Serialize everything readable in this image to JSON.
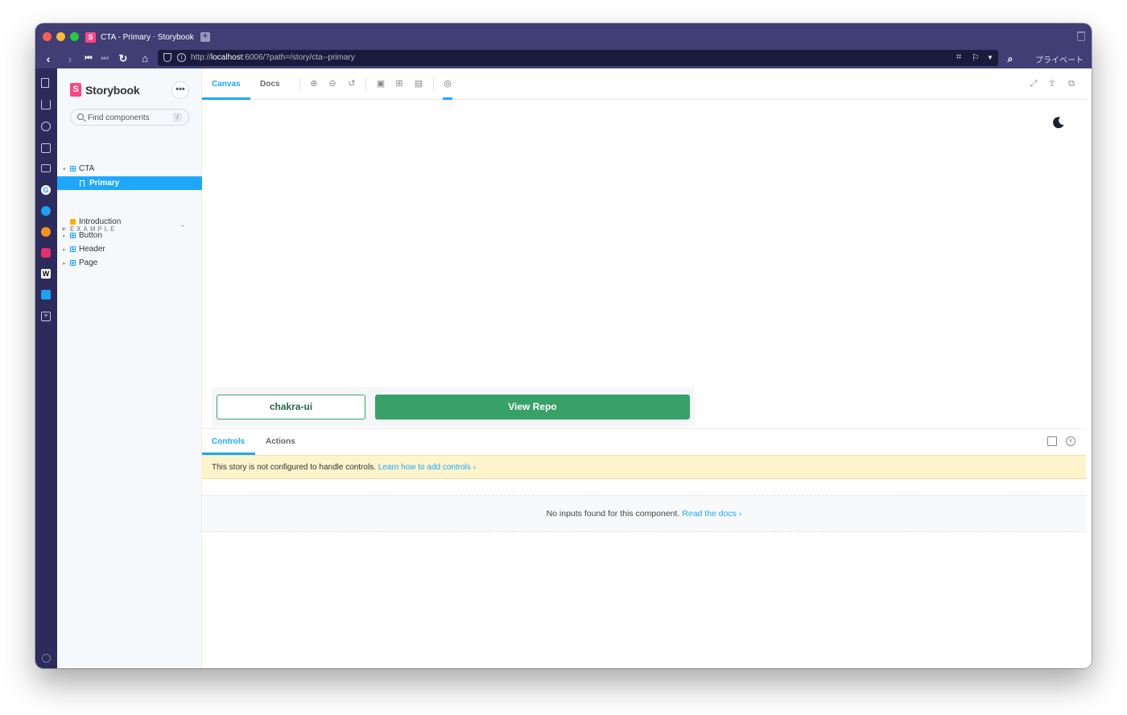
{
  "browser": {
    "tab_title": "CTA - Primary ⋅ Storybook",
    "tab_favicon": "S",
    "new_tab_symbol": "+",
    "url_prefix": "http://",
    "url_host": "localhost",
    "url_rest": ":6006/?path=/story/cta--primary",
    "private_label": "プライベート",
    "window_colors": {
      "close": "#ff5f57",
      "minimize": "#febc2e",
      "zoom": "#28c840",
      "chrome": "#403e74",
      "rail": "#2c2b5c"
    }
  },
  "sidebar": {
    "brand_icon": "S",
    "brand": "Storybook",
    "menu_label": "•••",
    "search_placeholder": "Find components",
    "search_shortcut": "/",
    "tree": [
      {
        "label": "CTA",
        "type": "component"
      },
      {
        "label": "Primary",
        "type": "story",
        "selected": true
      }
    ],
    "group": {
      "label": "EXAMPLE",
      "items": [
        {
          "label": "Introduction",
          "type": "docs"
        },
        {
          "label": "Button",
          "type": "component"
        },
        {
          "label": "Header",
          "type": "component"
        },
        {
          "label": "Page",
          "type": "component"
        }
      ]
    }
  },
  "toolbar": {
    "tabs": [
      "Canvas",
      "Docs"
    ],
    "active_tab": "Canvas",
    "tools": [
      "zoom-in-icon",
      "zoom-out-icon",
      "zoom-reset-icon",
      "background-icon",
      "grid-icon",
      "measure-icon",
      "globe-icon"
    ],
    "right_tools": [
      "fullscreen-icon",
      "share-icon",
      "copy-link-icon"
    ]
  },
  "canvas": {
    "button_outline": "chakra-ui",
    "button_primary": "View Repo",
    "accent": "#38a169"
  },
  "panel": {
    "tabs": [
      "Controls",
      "Actions"
    ],
    "active_tab": "Controls",
    "warning_text": "This story is not configured to handle controls.",
    "warning_link": "Learn how to add controls ›",
    "empty_text": "No inputs found for this component.",
    "empty_link": "Read the docs ›"
  },
  "theme": {
    "storybook_accent": "#1ea7fd",
    "storybook_pink": "#ff4785"
  }
}
